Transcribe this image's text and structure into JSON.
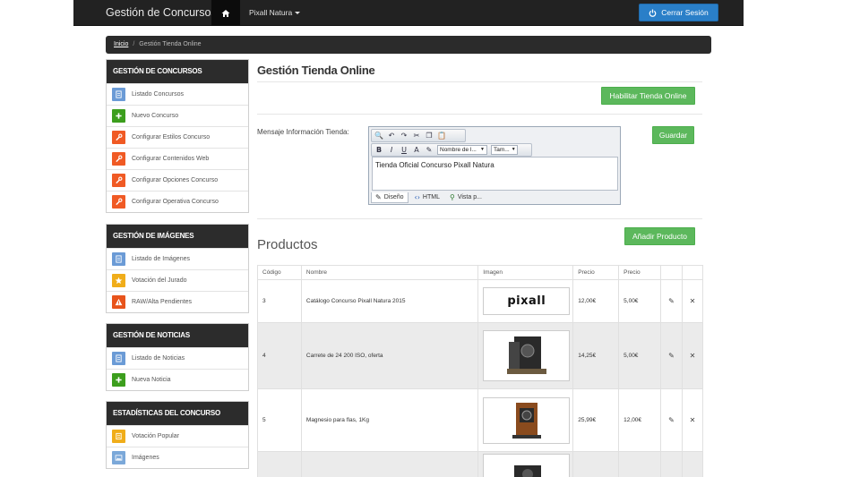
{
  "topbar": {
    "brand": "Gestión de Concursos",
    "context_menu": "Pixall Natura",
    "logout_label": "Cerrar Sesión"
  },
  "breadcrumb": {
    "home": "Inicio",
    "separator": "/",
    "current": "Gestión Tienda Online"
  },
  "sidebar": {
    "panels": [
      {
        "title": "Gestión de Concursos",
        "items": [
          {
            "label": "Listado Concursos",
            "icon": "document-icon",
            "color": "#6b9bd6"
          },
          {
            "label": "Nuevo Concurso",
            "icon": "plus-icon",
            "color": "#3c9e1d"
          },
          {
            "label": "Configurar Estilos Concurso",
            "icon": "wrench-icon",
            "color": "#f05a24"
          },
          {
            "label": "Configurar Contenidos Web",
            "icon": "wrench-icon",
            "color": "#f05a24"
          },
          {
            "label": "Configurar Opciones Concurso",
            "icon": "wrench-icon",
            "color": "#f05a24"
          },
          {
            "label": "Configurar Operativa Concurso",
            "icon": "wrench-icon",
            "color": "#f05a24"
          }
        ]
      },
      {
        "title": "Gestión de Imágenes",
        "items": [
          {
            "label": "Listado de Imágenes",
            "icon": "document-icon",
            "color": "#6b9bd6"
          },
          {
            "label": "Votación del Jurado",
            "icon": "star-icon",
            "color": "#f0ad1a"
          },
          {
            "label": "RAW/Alta Pendientes",
            "icon": "warning-icon",
            "color": "#e8541c"
          }
        ]
      },
      {
        "title": "Gestión de Noticias",
        "items": [
          {
            "label": "Listado de Noticias",
            "icon": "document-icon",
            "color": "#6b9bd6"
          },
          {
            "label": "Nueva Noticia",
            "icon": "plus-icon",
            "color": "#3c9e1d"
          }
        ]
      },
      {
        "title": "Estadísticas del Concurso",
        "items": [
          {
            "label": "Votación Popular",
            "icon": "ballot-icon",
            "color": "#f0ad1a"
          },
          {
            "label": "Imágenes",
            "icon": "image-icon",
            "color": "#7ba8d9"
          }
        ]
      }
    ]
  },
  "main": {
    "title": "Gestión Tienda Online",
    "enable_shop_label": "Habilitar Tienda Online",
    "message_label": "Mensaje Información Tienda:",
    "save_label": "Guardar",
    "editor": {
      "font_name_select": "Nombre de l...",
      "font_size_select": "Tam...",
      "content": "Tienda Oficial Concurso Pixall Natura",
      "tabs": [
        "Diseño",
        "HTML",
        "Vista p..."
      ]
    },
    "products_title": "Productos",
    "add_product_label": "Añadir Producto",
    "table": {
      "headers": [
        "Código",
        "Nombre",
        "Imagen",
        "Precio",
        "Precio",
        "",
        ""
      ],
      "rows": [
        {
          "code": "3",
          "name": "Catálogo Concurso Pixall Natura 2015",
          "price1": "12,00€",
          "price2": "5,00€",
          "image": "pixall-logo"
        },
        {
          "code": "4",
          "name": "Carrete de 24 200 ISO, oferta",
          "price1": "14,25€",
          "price2": "5,00€",
          "image": "camera-photo"
        },
        {
          "code": "5",
          "name": "Magnesio para flas, 1Kg",
          "price1": "25,99€",
          "price2": "12,00€",
          "image": "camera-photo"
        },
        {
          "code": "",
          "name": "",
          "price1": "",
          "price2": "",
          "image": "camera-photo"
        }
      ],
      "logo_text": "pixall"
    }
  }
}
